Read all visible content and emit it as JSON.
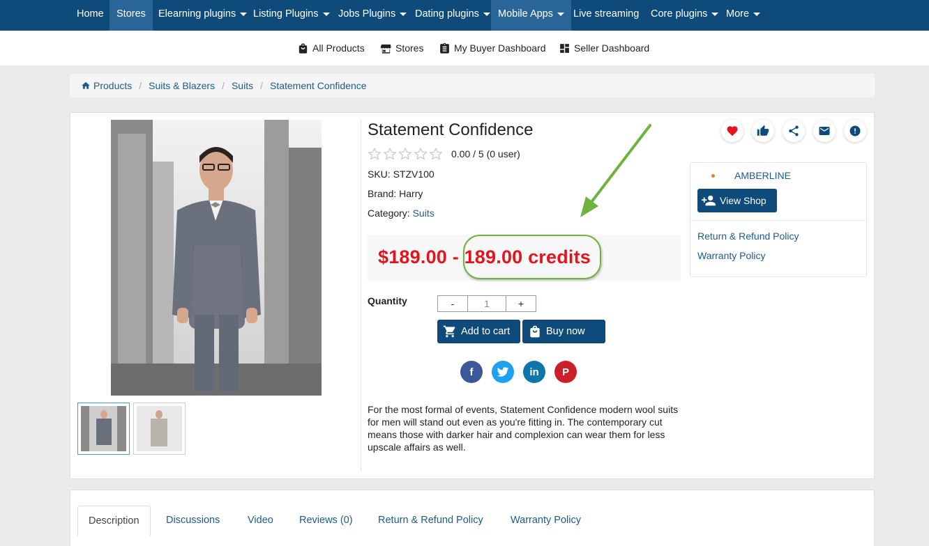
{
  "topnav": {
    "items": [
      {
        "label": "Home",
        "caret": false,
        "active": false
      },
      {
        "label": "Stores",
        "caret": false,
        "active": true
      },
      {
        "label": "Elearning plugins",
        "caret": true,
        "active": false
      },
      {
        "label": "Listing Plugins",
        "caret": true,
        "active": false
      },
      {
        "label": "Jobs Plugins",
        "caret": true,
        "active": false
      },
      {
        "label": "Dating plugins",
        "caret": true,
        "active": false
      },
      {
        "label": "Mobile Apps",
        "caret": true,
        "active": true
      },
      {
        "label": "Live streaming",
        "caret": false,
        "active": false
      },
      {
        "label": "Core plugins",
        "caret": true,
        "active": false
      },
      {
        "label": "More",
        "caret": true,
        "active": false
      }
    ]
  },
  "subnav": {
    "all_products": "All Products",
    "stores": "Stores",
    "buyer_dashboard": "My Buyer Dashboard",
    "seller_dashboard": "Seller Dashboard"
  },
  "breadcrumb": [
    "Products",
    "Suits & Blazers",
    "Suits",
    "Statement Confidence"
  ],
  "product": {
    "title": "Statement Confidence",
    "rating_text": "0.00 / 5 (0 user)",
    "rating_value": 0,
    "rating_max": 5,
    "sku": "SKU: STZV100",
    "brand": "Brand: Harry",
    "category_label": "Category:",
    "category_value": "Suits",
    "price_text": "$189.00 - 189.00 credits",
    "quantity_label": "Quantity",
    "qty_minus": "-",
    "qty_value": "1",
    "qty_plus": "+",
    "add_to_cart": "Add to cart",
    "buy_now": "Buy now",
    "description": "For the most formal of events, Statement Confidence modern wool suits for men will stand out even as you're fitting in. The contemporary cut means those with darker hair and complexion can wear them for less upscale affairs as well."
  },
  "seller": {
    "name": "AMBERLINE",
    "view_shop": "View Shop",
    "return_policy": "Return & Refund Policy",
    "warranty_policy": "Warranty Policy"
  },
  "tabs": [
    "Description",
    "Discussions",
    "Video",
    "Reviews (0)",
    "Return & Refund Policy",
    "Warranty Policy"
  ],
  "colors": {
    "nav": "#0f4b7a",
    "nav_active": "#2a6597",
    "link": "#1f5a88",
    "price": "#e4141c",
    "annotation": "#6fb33d"
  },
  "icons": [
    "home-icon",
    "bag-icon",
    "store-icon",
    "clipboard-icon",
    "dashboard-icon",
    "heart-icon",
    "thumbs-up-icon",
    "share-icon",
    "mail-icon",
    "report-icon",
    "cart-icon",
    "shopping-bag-icon",
    "add-user-icon",
    "facebook-icon",
    "twitter-icon",
    "linkedin-icon",
    "pinterest-icon"
  ]
}
